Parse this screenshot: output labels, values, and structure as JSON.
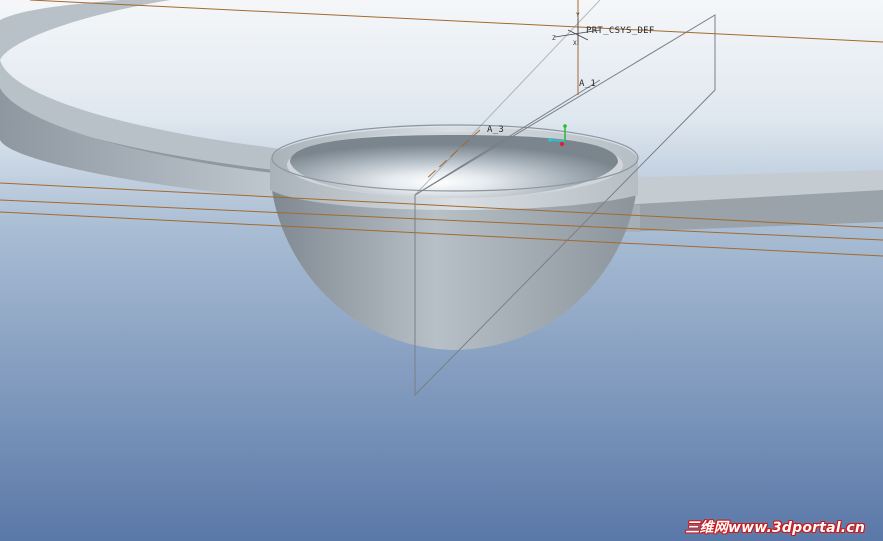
{
  "viewport": {
    "background_top": "#f4f6f8",
    "background_bottom": "#5c79a8",
    "datum_color": "#a36a30"
  },
  "model": {
    "part": "hemispherical bowl with flat ring"
  },
  "datums": {
    "csys_label": "PRT_CSYS_DEF",
    "axis_1_label": "A_1",
    "axis_3_label": "A_3",
    "csys_y": "Y",
    "csys_x": "X",
    "csys_z": "Z"
  },
  "watermark": {
    "text": "三维网www.3dportal.cn",
    "color": "#d01818"
  }
}
